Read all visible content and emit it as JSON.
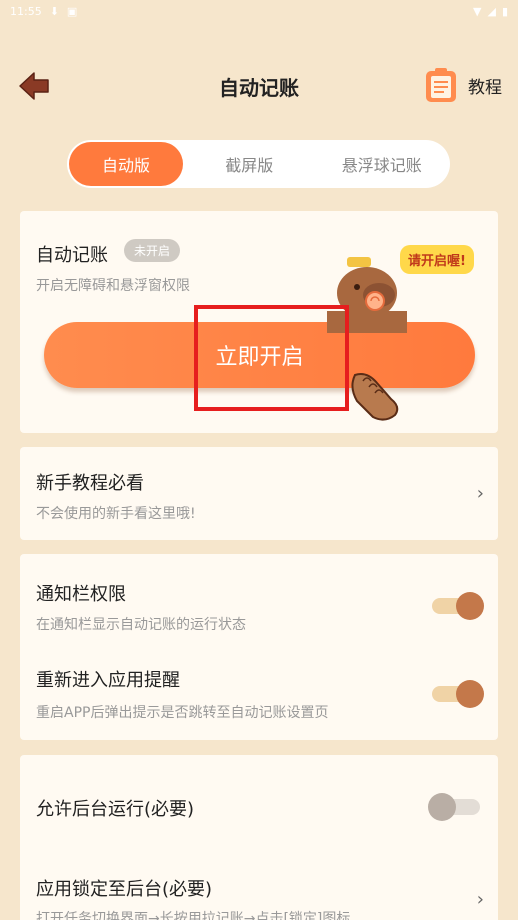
{
  "status_bar": {
    "time": "11:55"
  },
  "header": {
    "title": "自动记账",
    "tutorial_label": "教程"
  },
  "tabs": [
    {
      "label": "自动版",
      "active": true
    },
    {
      "label": "截屏版",
      "active": false
    },
    {
      "label": "悬浮球记账",
      "active": false
    }
  ],
  "auto_card": {
    "title": "自动记账",
    "badge": "未开启",
    "description": "开启无障碍和悬浮窗权限",
    "button_label": "立即开启",
    "bubble": "请开启喔!"
  },
  "guide_card": {
    "title": "新手教程必看",
    "description": "不会使用的新手看这里哦!"
  },
  "settings": [
    {
      "title": "通知栏权限",
      "description": "在通知栏显示自动记账的运行状态",
      "toggle": "on"
    },
    {
      "title": "重新进入应用提醒",
      "description": "重启APP后弹出提示是否跳转至自动记账设置页",
      "toggle": "on"
    }
  ],
  "background_card": {
    "run_title": "允许后台运行(必要)",
    "run_toggle": "off",
    "lock_title": "应用锁定至后台(必要)",
    "lock_description": "打开任务切换界面→长按用拉记账→点击[锁定]图标"
  },
  "colors": {
    "accent": "#ff7a3d",
    "background": "#f6e6cc",
    "toggle_on": "#c4784a",
    "highlight_box": "#e61e1e"
  }
}
